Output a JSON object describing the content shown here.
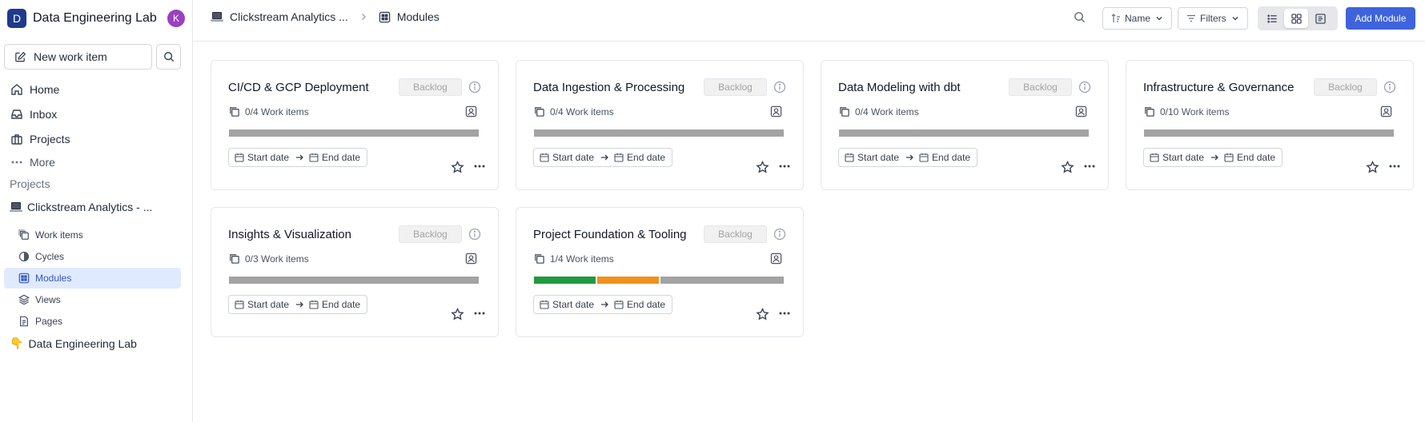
{
  "workspace": {
    "logo_letter": "D",
    "name": "Data Engineering Lab",
    "avatar_letter": "K"
  },
  "sidebar": {
    "new_item_label": "New work item",
    "nav": [
      {
        "label": "Home",
        "icon": "home-icon"
      },
      {
        "label": "Inbox",
        "icon": "inbox-icon"
      },
      {
        "label": "Projects",
        "icon": "briefcase-icon"
      },
      {
        "label": "More",
        "icon": "ellipsis-icon"
      }
    ],
    "projects_title": "Projects",
    "project_name": "Clickstream Analytics - ...",
    "project_items": [
      {
        "label": "Work items",
        "icon": "layers-icon",
        "active": false
      },
      {
        "label": "Cycles",
        "icon": "contrast-icon",
        "active": false
      },
      {
        "label": "Modules",
        "icon": "grid-icon",
        "active": true
      },
      {
        "label": "Views",
        "icon": "stack-icon",
        "active": false
      },
      {
        "label": "Pages",
        "icon": "page-icon",
        "active": false
      }
    ],
    "project2_name": "Data Engineering Lab",
    "project2_emoji": "👇"
  },
  "header": {
    "breadcrumb_project": "Clickstream Analytics ...",
    "breadcrumb_page": "Modules",
    "sort_label": "Name",
    "filters_label": "Filters",
    "active_view": "grid",
    "add_button_label": "Add Module"
  },
  "colors": {
    "accent": "#3e63dd",
    "done": "#1f9a3f",
    "in_progress": "#f0911e",
    "pending": "#a3a3a3",
    "active_bg": "#e0eaff"
  },
  "modules": [
    {
      "title": "CI/CD & GCP Deployment",
      "status": "Backlog",
      "work_items": "0/4 Work items",
      "start": "Start date",
      "end": "End date",
      "progress": [
        {
          "type": "pending",
          "value": 4
        }
      ]
    },
    {
      "title": "Data Ingestion & Processing",
      "status": "Backlog",
      "work_items": "0/4 Work items",
      "start": "Start date",
      "end": "End date",
      "progress": [
        {
          "type": "pending",
          "value": 4
        }
      ]
    },
    {
      "title": "Data Modeling with dbt",
      "status": "Backlog",
      "work_items": "0/4 Work items",
      "start": "Start date",
      "end": "End date",
      "progress": [
        {
          "type": "pending",
          "value": 4
        }
      ]
    },
    {
      "title": "Infrastructure & Governance",
      "status": "Backlog",
      "work_items": "0/10 Work items",
      "start": "Start date",
      "end": "End date",
      "progress": [
        {
          "type": "pending",
          "value": 10
        }
      ]
    },
    {
      "title": "Insights & Visualization",
      "status": "Backlog",
      "work_items": "0/3 Work items",
      "start": "Start date",
      "end": "End date",
      "progress": [
        {
          "type": "pending",
          "value": 3
        }
      ]
    },
    {
      "title": "Project Foundation & Tooling",
      "status": "Backlog",
      "work_items": "1/4 Work items",
      "start": "Start date",
      "end": "End date",
      "progress": [
        {
          "type": "done",
          "value": 1
        },
        {
          "type": "in_progress",
          "value": 1
        },
        {
          "type": "pending",
          "value": 2
        }
      ]
    }
  ]
}
